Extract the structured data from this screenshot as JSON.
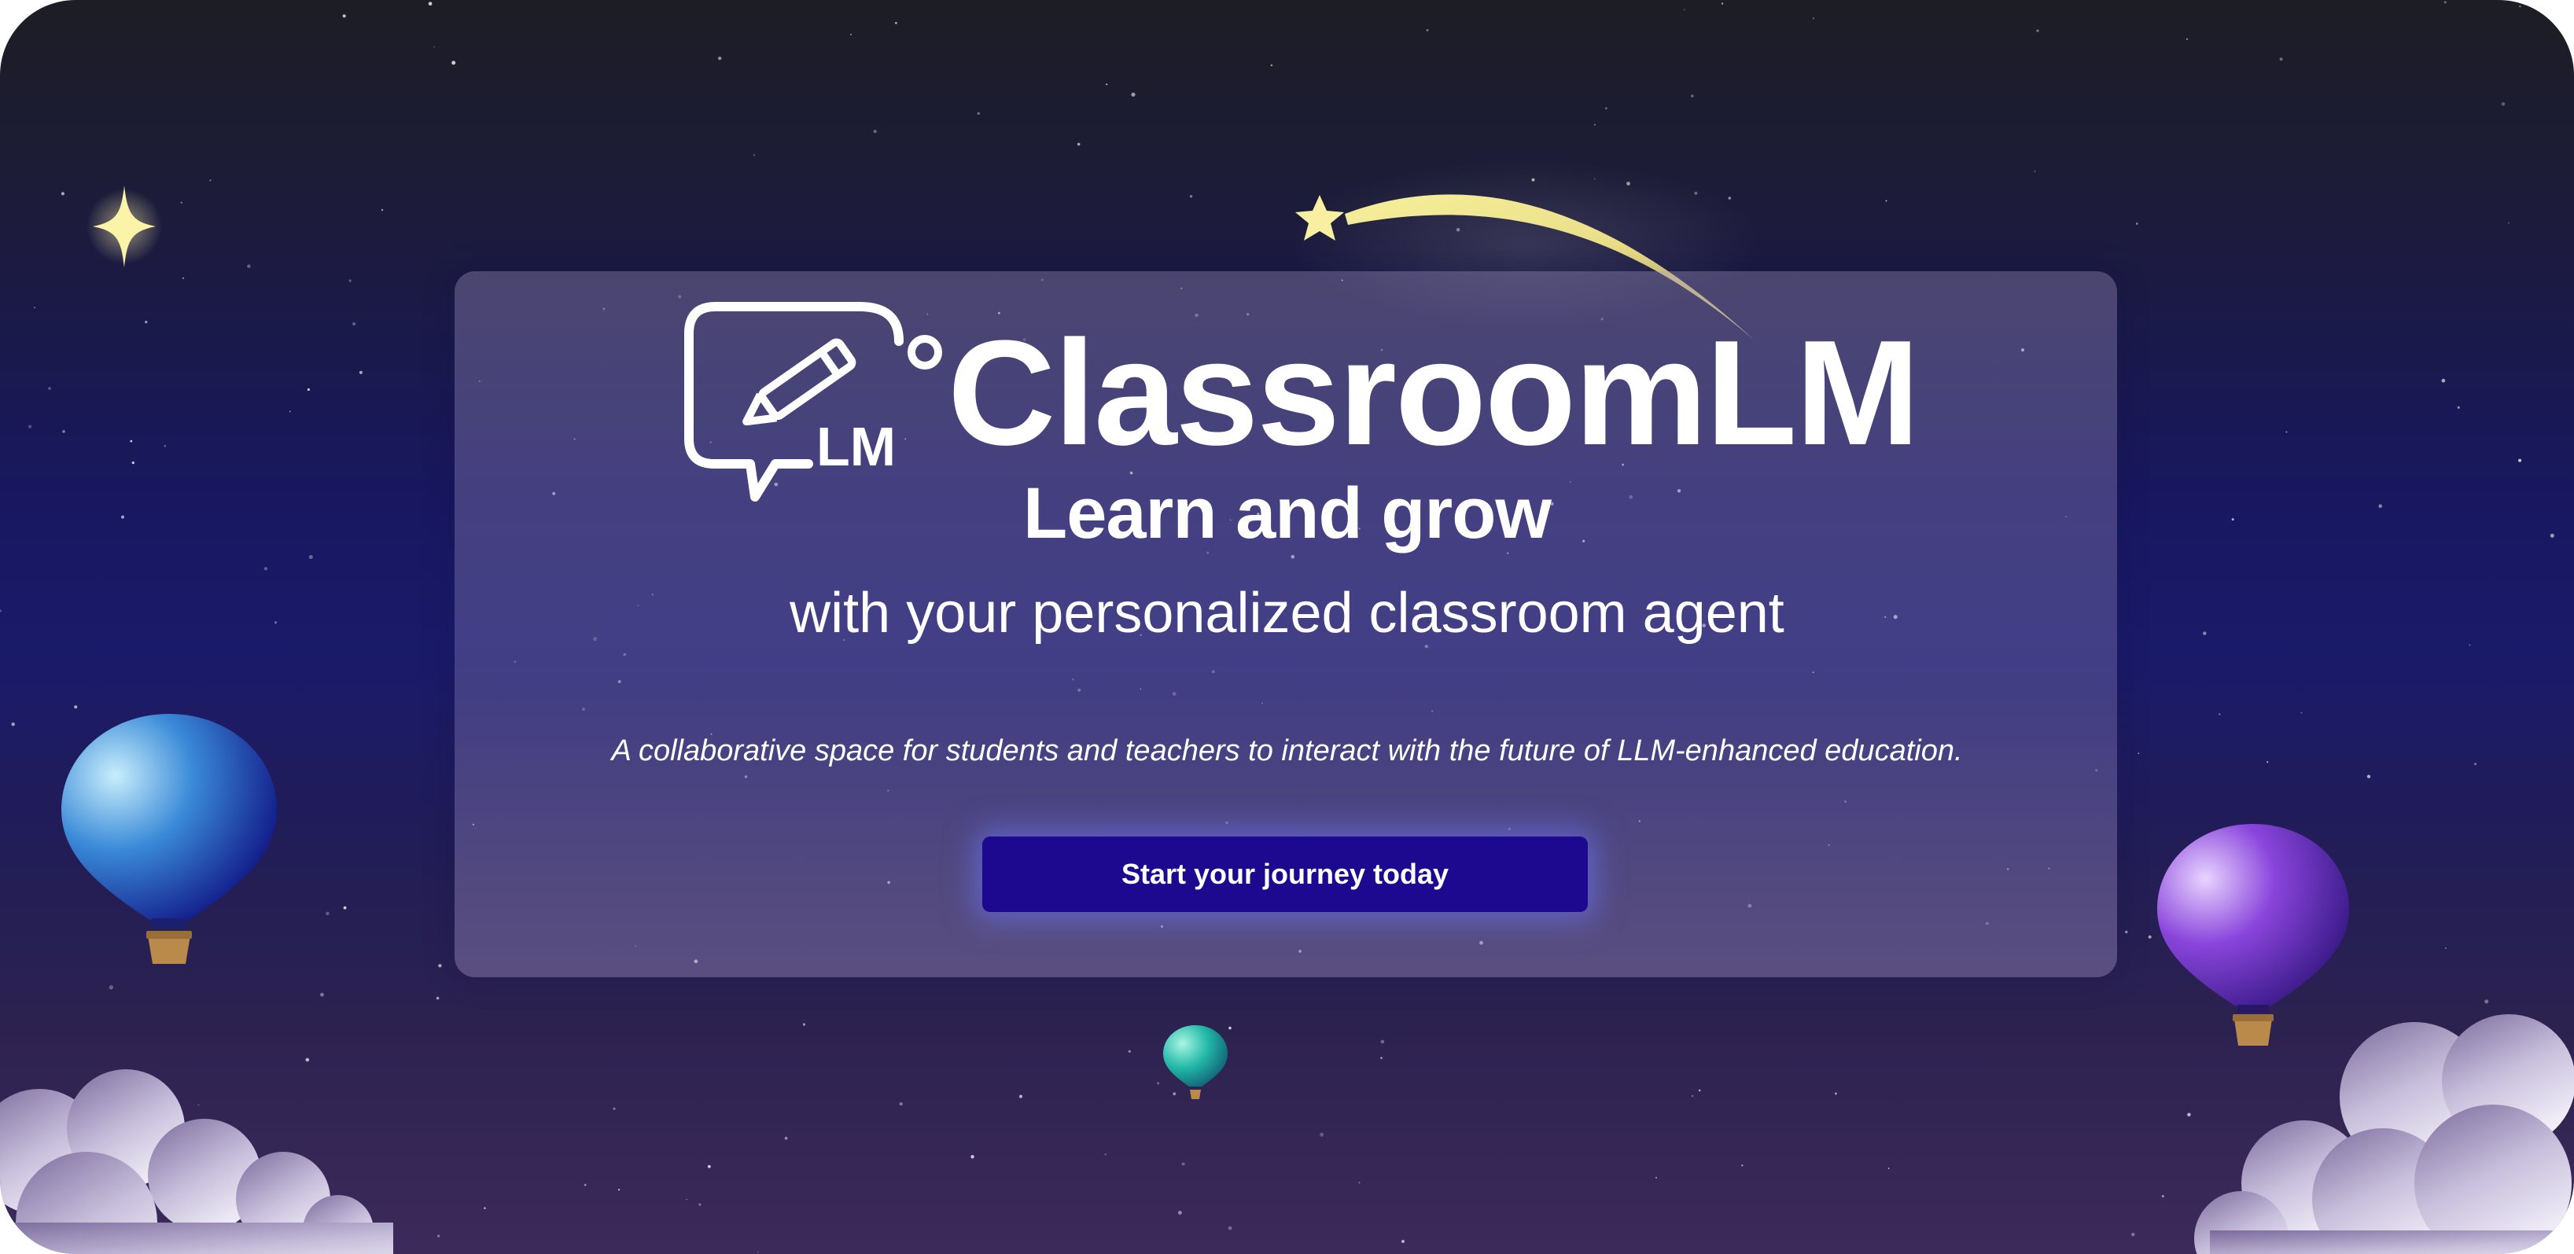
{
  "brand": {
    "name": "ClassroomLM",
    "logo_text": "LM",
    "logo_icon": "chat-bubble-pencil-icon"
  },
  "hero": {
    "headline": "Learn and grow",
    "subheadline": "with your personalized classroom agent",
    "tagline": "A collaborative space for students and teachers to interact with the future of LLM-enhanced education.",
    "cta_label": "Start your journey today"
  },
  "decorations": {
    "sparkle": "four-point-star-icon",
    "shooting_star": "shooting-star-icon",
    "balloons": [
      "blue-balloon-icon",
      "purple-balloon-icon",
      "teal-balloon-icon"
    ],
    "clouds": [
      "cloud-icon",
      "cloud-icon"
    ]
  },
  "colors": {
    "cta_background": "#1c0990",
    "star_glow": "#f7ee9a",
    "background_top": "#1d1d24",
    "background_mid": "#181760",
    "background_bottom": "#3c2a5a"
  }
}
